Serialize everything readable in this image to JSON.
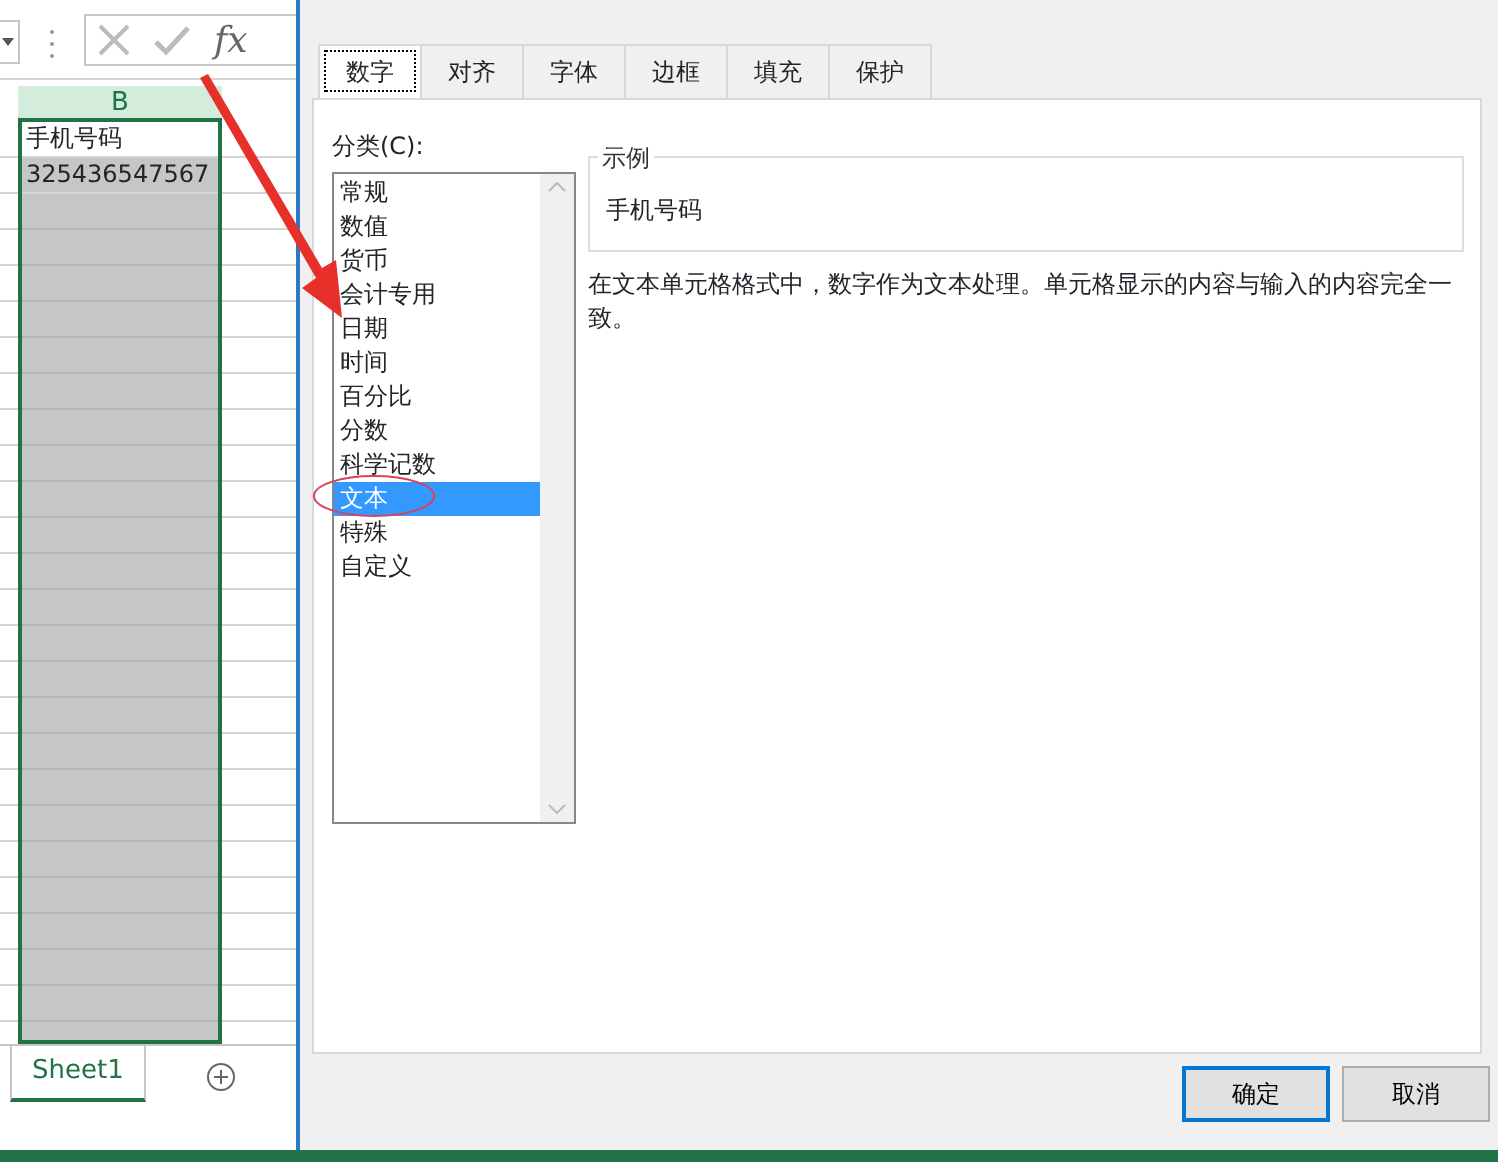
{
  "formula_bar": {
    "function_label": "fx"
  },
  "sheet": {
    "column_header": "B",
    "selected_column": true,
    "cells": [
      {
        "text": "手机号码",
        "selected": false
      },
      {
        "text": "325436547567",
        "selected": true
      }
    ],
    "empty_rows_selected": true
  },
  "sheet_tabs": [
    {
      "label": "Sheet1",
      "selected": true
    }
  ],
  "dialog": {
    "tabs": [
      {
        "label": "数字",
        "selected": true
      },
      {
        "label": "对齐",
        "selected": false
      },
      {
        "label": "字体",
        "selected": false
      },
      {
        "label": "边框",
        "selected": false
      },
      {
        "label": "填充",
        "selected": false
      },
      {
        "label": "保护",
        "selected": false
      }
    ],
    "category_label": "分类(C):",
    "categories": [
      {
        "label": "常规",
        "selected": false
      },
      {
        "label": "数值",
        "selected": false
      },
      {
        "label": "货币",
        "selected": false
      },
      {
        "label": "会计专用",
        "selected": false
      },
      {
        "label": "日期",
        "selected": false
      },
      {
        "label": "时间",
        "selected": false
      },
      {
        "label": "百分比",
        "selected": false
      },
      {
        "label": "分数",
        "selected": false
      },
      {
        "label": "科学记数",
        "selected": false
      },
      {
        "label": "文本",
        "selected": true
      },
      {
        "label": "特殊",
        "selected": false
      },
      {
        "label": "自定义",
        "selected": false
      }
    ],
    "sample": {
      "label": "示例",
      "value": "手机号码"
    },
    "description": "在文本单元格格式中，数字作为文本处理。单元格显示的内容与输入的内容完全一致。",
    "buttons": [
      {
        "label": "确定",
        "default": true
      },
      {
        "label": "取消",
        "default": false
      }
    ]
  }
}
